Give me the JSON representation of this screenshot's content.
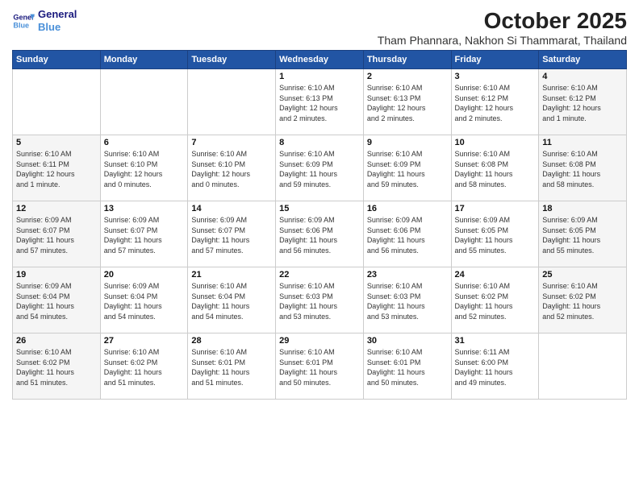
{
  "header": {
    "logo_line1": "General",
    "logo_line2": "Blue",
    "month_title": "October 2025",
    "subtitle": "Tham Phannara, Nakhon Si Thammarat, Thailand"
  },
  "weekdays": [
    "Sunday",
    "Monday",
    "Tuesday",
    "Wednesday",
    "Thursday",
    "Friday",
    "Saturday"
  ],
  "weeks": [
    [
      {
        "day": "",
        "info": ""
      },
      {
        "day": "",
        "info": ""
      },
      {
        "day": "",
        "info": ""
      },
      {
        "day": "1",
        "info": "Sunrise: 6:10 AM\nSunset: 6:13 PM\nDaylight: 12 hours\nand 2 minutes."
      },
      {
        "day": "2",
        "info": "Sunrise: 6:10 AM\nSunset: 6:13 PM\nDaylight: 12 hours\nand 2 minutes."
      },
      {
        "day": "3",
        "info": "Sunrise: 6:10 AM\nSunset: 6:12 PM\nDaylight: 12 hours\nand 2 minutes."
      },
      {
        "day": "4",
        "info": "Sunrise: 6:10 AM\nSunset: 6:12 PM\nDaylight: 12 hours\nand 1 minute."
      }
    ],
    [
      {
        "day": "5",
        "info": "Sunrise: 6:10 AM\nSunset: 6:11 PM\nDaylight: 12 hours\nand 1 minute."
      },
      {
        "day": "6",
        "info": "Sunrise: 6:10 AM\nSunset: 6:10 PM\nDaylight: 12 hours\nand 0 minutes."
      },
      {
        "day": "7",
        "info": "Sunrise: 6:10 AM\nSunset: 6:10 PM\nDaylight: 12 hours\nand 0 minutes."
      },
      {
        "day": "8",
        "info": "Sunrise: 6:10 AM\nSunset: 6:09 PM\nDaylight: 11 hours\nand 59 minutes."
      },
      {
        "day": "9",
        "info": "Sunrise: 6:10 AM\nSunset: 6:09 PM\nDaylight: 11 hours\nand 59 minutes."
      },
      {
        "day": "10",
        "info": "Sunrise: 6:10 AM\nSunset: 6:08 PM\nDaylight: 11 hours\nand 58 minutes."
      },
      {
        "day": "11",
        "info": "Sunrise: 6:10 AM\nSunset: 6:08 PM\nDaylight: 11 hours\nand 58 minutes."
      }
    ],
    [
      {
        "day": "12",
        "info": "Sunrise: 6:09 AM\nSunset: 6:07 PM\nDaylight: 11 hours\nand 57 minutes."
      },
      {
        "day": "13",
        "info": "Sunrise: 6:09 AM\nSunset: 6:07 PM\nDaylight: 11 hours\nand 57 minutes."
      },
      {
        "day": "14",
        "info": "Sunrise: 6:09 AM\nSunset: 6:07 PM\nDaylight: 11 hours\nand 57 minutes."
      },
      {
        "day": "15",
        "info": "Sunrise: 6:09 AM\nSunset: 6:06 PM\nDaylight: 11 hours\nand 56 minutes."
      },
      {
        "day": "16",
        "info": "Sunrise: 6:09 AM\nSunset: 6:06 PM\nDaylight: 11 hours\nand 56 minutes."
      },
      {
        "day": "17",
        "info": "Sunrise: 6:09 AM\nSunset: 6:05 PM\nDaylight: 11 hours\nand 55 minutes."
      },
      {
        "day": "18",
        "info": "Sunrise: 6:09 AM\nSunset: 6:05 PM\nDaylight: 11 hours\nand 55 minutes."
      }
    ],
    [
      {
        "day": "19",
        "info": "Sunrise: 6:09 AM\nSunset: 6:04 PM\nDaylight: 11 hours\nand 54 minutes."
      },
      {
        "day": "20",
        "info": "Sunrise: 6:09 AM\nSunset: 6:04 PM\nDaylight: 11 hours\nand 54 minutes."
      },
      {
        "day": "21",
        "info": "Sunrise: 6:10 AM\nSunset: 6:04 PM\nDaylight: 11 hours\nand 54 minutes."
      },
      {
        "day": "22",
        "info": "Sunrise: 6:10 AM\nSunset: 6:03 PM\nDaylight: 11 hours\nand 53 minutes."
      },
      {
        "day": "23",
        "info": "Sunrise: 6:10 AM\nSunset: 6:03 PM\nDaylight: 11 hours\nand 53 minutes."
      },
      {
        "day": "24",
        "info": "Sunrise: 6:10 AM\nSunset: 6:02 PM\nDaylight: 11 hours\nand 52 minutes."
      },
      {
        "day": "25",
        "info": "Sunrise: 6:10 AM\nSunset: 6:02 PM\nDaylight: 11 hours\nand 52 minutes."
      }
    ],
    [
      {
        "day": "26",
        "info": "Sunrise: 6:10 AM\nSunset: 6:02 PM\nDaylight: 11 hours\nand 51 minutes."
      },
      {
        "day": "27",
        "info": "Sunrise: 6:10 AM\nSunset: 6:02 PM\nDaylight: 11 hours\nand 51 minutes."
      },
      {
        "day": "28",
        "info": "Sunrise: 6:10 AM\nSunset: 6:01 PM\nDaylight: 11 hours\nand 51 minutes."
      },
      {
        "day": "29",
        "info": "Sunrise: 6:10 AM\nSunset: 6:01 PM\nDaylight: 11 hours\nand 50 minutes."
      },
      {
        "day": "30",
        "info": "Sunrise: 6:10 AM\nSunset: 6:01 PM\nDaylight: 11 hours\nand 50 minutes."
      },
      {
        "day": "31",
        "info": "Sunrise: 6:11 AM\nSunset: 6:00 PM\nDaylight: 11 hours\nand 49 minutes."
      },
      {
        "day": "",
        "info": ""
      }
    ]
  ]
}
